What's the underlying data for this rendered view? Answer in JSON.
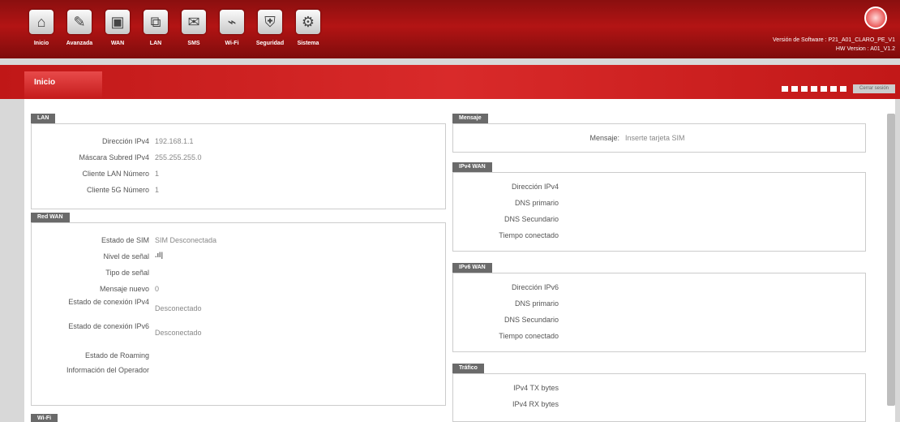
{
  "nav": {
    "items": [
      {
        "label": "Inicio",
        "icon": "home-icon",
        "glyph": "⌂"
      },
      {
        "label": "Avanzada",
        "icon": "tools-icon",
        "glyph": "✎"
      },
      {
        "label": "WAN",
        "icon": "monitor-icon",
        "glyph": "▣"
      },
      {
        "label": "LAN",
        "icon": "network-icon",
        "glyph": "⧉"
      },
      {
        "label": "SMS",
        "icon": "mail-icon",
        "glyph": "✉"
      },
      {
        "label": "Wi-Fi",
        "icon": "wifi-icon",
        "glyph": "⌁"
      },
      {
        "label": "Seguridad",
        "icon": "shield-icon",
        "glyph": "⛨"
      },
      {
        "label": "Sistema",
        "icon": "gear-icon",
        "glyph": "⚙"
      }
    ]
  },
  "header": {
    "software_version": "Versión de Software : P21_A01_CLARO_PE_V1",
    "hw_version": "HW Version : A01_V1.2"
  },
  "tab": {
    "label": "Inicio"
  },
  "logout": {
    "label": "Cerrar sesión"
  },
  "lan": {
    "title": "LAN",
    "rows": [
      {
        "label": "Dirección IPv4",
        "value": "192.168.1.1"
      },
      {
        "label": "Máscara Subred IPv4",
        "value": "255.255.255.0"
      },
      {
        "label": "Cliente LAN Número",
        "value": "1"
      },
      {
        "label": "Cliente 5G Número",
        "value": "1"
      }
    ]
  },
  "wan": {
    "title": "Red WAN",
    "rows": [
      {
        "label": "Estado de SIM",
        "value": "SIM Desconectada"
      },
      {
        "label": "Nivel de señal",
        "value": ""
      },
      {
        "label": "Tipo de señal",
        "value": ""
      },
      {
        "label": "Mensaje nuevo",
        "value": "0"
      },
      {
        "label": "Estado de conexión IPv4",
        "value": "Desconectado"
      },
      {
        "label": "Estado de conexión IPv6",
        "value": "Desconectado"
      },
      {
        "label": "Estado de Roaming",
        "value": ""
      },
      {
        "label": "Información del Operador",
        "value": ""
      }
    ]
  },
  "bottom_left": {
    "title": "Wi-Fi"
  },
  "message": {
    "title": "Mensaje",
    "label": "Mensaje:",
    "value": "Inserte tarjeta SIM"
  },
  "ipv4": {
    "title": "IPv4 WAN",
    "rows": [
      {
        "label": "Dirección IPv4"
      },
      {
        "label": "DNS primario"
      },
      {
        "label": "DNS Secundario"
      },
      {
        "label": "Tiempo conectado"
      }
    ]
  },
  "ipv6": {
    "title": "IPv6 WAN",
    "rows": [
      {
        "label": "Dirección IPv6"
      },
      {
        "label": "DNS primario"
      },
      {
        "label": "DNS Secundario"
      },
      {
        "label": "Tiempo conectado"
      }
    ]
  },
  "traffic": {
    "title": "Tráfico",
    "rows": [
      {
        "label": "IPv4 TX bytes"
      },
      {
        "label": "IPv4 RX bytes"
      }
    ]
  },
  "colors": {
    "accent": "#c81c1c",
    "panel_header": "#6a6a6a"
  }
}
